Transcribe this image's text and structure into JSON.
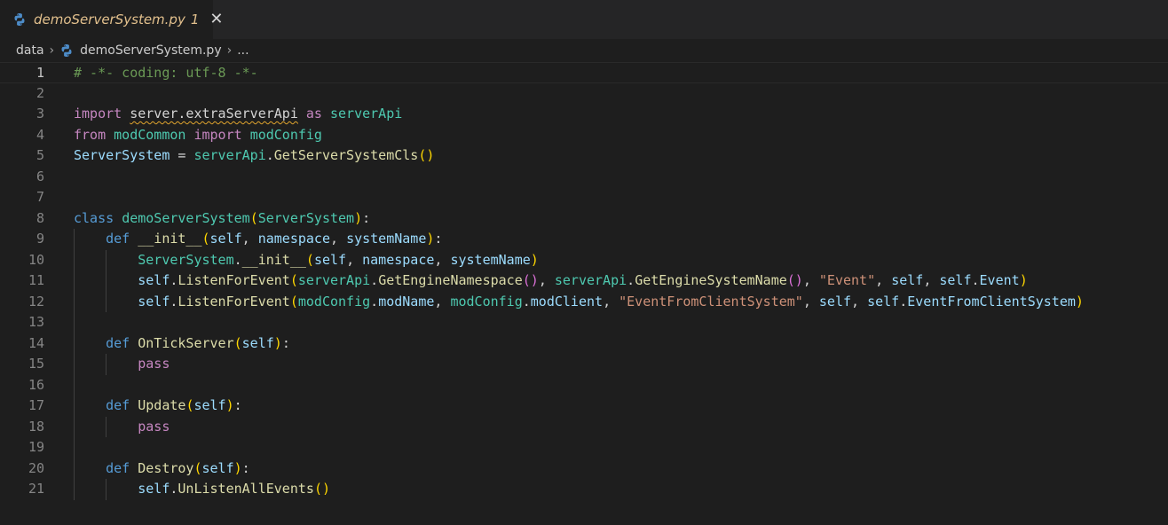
{
  "tab": {
    "file_name": "demoServerSystem.py",
    "problem_count": "1",
    "close_glyph": "✕",
    "icon": "python-icon"
  },
  "breadcrumb": {
    "folder": "data",
    "separator": "›",
    "file": "demoServerSystem.py",
    "ellipsis": "..."
  },
  "editor": {
    "current_line": 1,
    "lines": [
      {
        "n": "1",
        "indent": 0,
        "tokens": [
          {
            "t": "# -*- coding: utf-8 -*-",
            "c": "t-com"
          }
        ]
      },
      {
        "n": "2",
        "indent": 0,
        "tokens": []
      },
      {
        "n": "3",
        "indent": 0,
        "tokens": [
          {
            "t": "import",
            "c": "t-kw"
          },
          {
            "t": " ",
            "c": "t-txt"
          },
          {
            "t": "server.extraServerApi",
            "c": "t-txt squiggle"
          },
          {
            "t": " ",
            "c": "t-txt"
          },
          {
            "t": "as",
            "c": "t-kw"
          },
          {
            "t": " ",
            "c": "t-txt"
          },
          {
            "t": "serverApi",
            "c": "t-ns"
          }
        ]
      },
      {
        "n": "4",
        "indent": 0,
        "tokens": [
          {
            "t": "from",
            "c": "t-kw"
          },
          {
            "t": " ",
            "c": "t-txt"
          },
          {
            "t": "modCommon",
            "c": "t-ns"
          },
          {
            "t": " ",
            "c": "t-txt"
          },
          {
            "t": "import",
            "c": "t-kw"
          },
          {
            "t": " ",
            "c": "t-txt"
          },
          {
            "t": "modConfig",
            "c": "t-ns"
          }
        ]
      },
      {
        "n": "5",
        "indent": 0,
        "tokens": [
          {
            "t": "ServerSystem",
            "c": "t-var"
          },
          {
            "t": " = ",
            "c": "t-op"
          },
          {
            "t": "serverApi",
            "c": "t-ns"
          },
          {
            "t": ".",
            "c": "t-txt"
          },
          {
            "t": "GetServerSystemCls",
            "c": "t-fn"
          },
          {
            "t": "()",
            "c": "t-p1"
          }
        ]
      },
      {
        "n": "6",
        "indent": 0,
        "tokens": []
      },
      {
        "n": "7",
        "indent": 0,
        "tokens": []
      },
      {
        "n": "8",
        "indent": 0,
        "tokens": [
          {
            "t": "class",
            "c": "t-kwb"
          },
          {
            "t": " ",
            "c": "t-txt"
          },
          {
            "t": "demoServerSystem",
            "c": "t-cls"
          },
          {
            "t": "(",
            "c": "t-p1"
          },
          {
            "t": "ServerSystem",
            "c": "t-cls"
          },
          {
            "t": ")",
            "c": "t-p1"
          },
          {
            "t": ":",
            "c": "t-txt"
          }
        ]
      },
      {
        "n": "9",
        "indent": 1,
        "tokens": [
          {
            "t": "    ",
            "c": "t-txt"
          },
          {
            "t": "def",
            "c": "t-kwb"
          },
          {
            "t": " ",
            "c": "t-txt"
          },
          {
            "t": "__init__",
            "c": "t-fn"
          },
          {
            "t": "(",
            "c": "t-p1"
          },
          {
            "t": "self",
            "c": "t-var"
          },
          {
            "t": ", ",
            "c": "t-txt"
          },
          {
            "t": "namespace",
            "c": "t-var"
          },
          {
            "t": ", ",
            "c": "t-txt"
          },
          {
            "t": "systemName",
            "c": "t-var"
          },
          {
            "t": ")",
            "c": "t-p1"
          },
          {
            "t": ":",
            "c": "t-txt"
          }
        ]
      },
      {
        "n": "10",
        "indent": 2,
        "tokens": [
          {
            "t": "        ",
            "c": "t-txt"
          },
          {
            "t": "ServerSystem",
            "c": "t-cls"
          },
          {
            "t": ".",
            "c": "t-txt"
          },
          {
            "t": "__init__",
            "c": "t-fn"
          },
          {
            "t": "(",
            "c": "t-p1"
          },
          {
            "t": "self",
            "c": "t-var"
          },
          {
            "t": ", ",
            "c": "t-txt"
          },
          {
            "t": "namespace",
            "c": "t-var"
          },
          {
            "t": ", ",
            "c": "t-txt"
          },
          {
            "t": "systemName",
            "c": "t-var"
          },
          {
            "t": ")",
            "c": "t-p1"
          }
        ]
      },
      {
        "n": "11",
        "indent": 2,
        "tokens": [
          {
            "t": "        ",
            "c": "t-txt"
          },
          {
            "t": "self",
            "c": "t-var"
          },
          {
            "t": ".",
            "c": "t-txt"
          },
          {
            "t": "ListenForEvent",
            "c": "t-fn"
          },
          {
            "t": "(",
            "c": "t-p1"
          },
          {
            "t": "serverApi",
            "c": "t-ns"
          },
          {
            "t": ".",
            "c": "t-txt"
          },
          {
            "t": "GetEngineNamespace",
            "c": "t-fn"
          },
          {
            "t": "()",
            "c": "t-p2"
          },
          {
            "t": ", ",
            "c": "t-txt"
          },
          {
            "t": "serverApi",
            "c": "t-ns"
          },
          {
            "t": ".",
            "c": "t-txt"
          },
          {
            "t": "GetEngineSystemName",
            "c": "t-fn"
          },
          {
            "t": "()",
            "c": "t-p2"
          },
          {
            "t": ", ",
            "c": "t-txt"
          },
          {
            "t": "\"Event\"",
            "c": "t-str"
          },
          {
            "t": ", ",
            "c": "t-txt"
          },
          {
            "t": "self",
            "c": "t-var"
          },
          {
            "t": ", ",
            "c": "t-txt"
          },
          {
            "t": "self",
            "c": "t-var"
          },
          {
            "t": ".",
            "c": "t-txt"
          },
          {
            "t": "Event",
            "c": "t-var"
          },
          {
            "t": ")",
            "c": "t-p1"
          }
        ]
      },
      {
        "n": "12",
        "indent": 2,
        "tokens": [
          {
            "t": "        ",
            "c": "t-txt"
          },
          {
            "t": "self",
            "c": "t-var"
          },
          {
            "t": ".",
            "c": "t-txt"
          },
          {
            "t": "ListenForEvent",
            "c": "t-fn"
          },
          {
            "t": "(",
            "c": "t-p1"
          },
          {
            "t": "modConfig",
            "c": "t-ns"
          },
          {
            "t": ".",
            "c": "t-txt"
          },
          {
            "t": "modName",
            "c": "t-var"
          },
          {
            "t": ", ",
            "c": "t-txt"
          },
          {
            "t": "modConfig",
            "c": "t-ns"
          },
          {
            "t": ".",
            "c": "t-txt"
          },
          {
            "t": "modClient",
            "c": "t-var"
          },
          {
            "t": ", ",
            "c": "t-txt"
          },
          {
            "t": "\"EventFromClientSystem\"",
            "c": "t-str"
          },
          {
            "t": ", ",
            "c": "t-txt"
          },
          {
            "t": "self",
            "c": "t-var"
          },
          {
            "t": ", ",
            "c": "t-txt"
          },
          {
            "t": "self",
            "c": "t-var"
          },
          {
            "t": ".",
            "c": "t-txt"
          },
          {
            "t": "EventFromClientSystem",
            "c": "t-var"
          },
          {
            "t": ")",
            "c": "t-p1"
          }
        ]
      },
      {
        "n": "13",
        "indent": 1,
        "tokens": []
      },
      {
        "n": "14",
        "indent": 1,
        "tokens": [
          {
            "t": "    ",
            "c": "t-txt"
          },
          {
            "t": "def",
            "c": "t-kwb"
          },
          {
            "t": " ",
            "c": "t-txt"
          },
          {
            "t": "OnTickServer",
            "c": "t-fn"
          },
          {
            "t": "(",
            "c": "t-p1"
          },
          {
            "t": "self",
            "c": "t-var"
          },
          {
            "t": ")",
            "c": "t-p1"
          },
          {
            "t": ":",
            "c": "t-txt"
          }
        ]
      },
      {
        "n": "15",
        "indent": 2,
        "tokens": [
          {
            "t": "        ",
            "c": "t-txt"
          },
          {
            "t": "pass",
            "c": "t-kw"
          }
        ]
      },
      {
        "n": "16",
        "indent": 1,
        "tokens": []
      },
      {
        "n": "17",
        "indent": 1,
        "tokens": [
          {
            "t": "    ",
            "c": "t-txt"
          },
          {
            "t": "def",
            "c": "t-kwb"
          },
          {
            "t": " ",
            "c": "t-txt"
          },
          {
            "t": "Update",
            "c": "t-fn"
          },
          {
            "t": "(",
            "c": "t-p1"
          },
          {
            "t": "self",
            "c": "t-var"
          },
          {
            "t": ")",
            "c": "t-p1"
          },
          {
            "t": ":",
            "c": "t-txt"
          }
        ]
      },
      {
        "n": "18",
        "indent": 2,
        "tokens": [
          {
            "t": "        ",
            "c": "t-txt"
          },
          {
            "t": "pass",
            "c": "t-kw"
          }
        ]
      },
      {
        "n": "19",
        "indent": 1,
        "tokens": []
      },
      {
        "n": "20",
        "indent": 1,
        "tokens": [
          {
            "t": "    ",
            "c": "t-txt"
          },
          {
            "t": "def",
            "c": "t-kwb"
          },
          {
            "t": " ",
            "c": "t-txt"
          },
          {
            "t": "Destroy",
            "c": "t-fn"
          },
          {
            "t": "(",
            "c": "t-p1"
          },
          {
            "t": "self",
            "c": "t-var"
          },
          {
            "t": ")",
            "c": "t-p1"
          },
          {
            "t": ":",
            "c": "t-txt"
          }
        ]
      },
      {
        "n": "21",
        "indent": 2,
        "tokens": [
          {
            "t": "        ",
            "c": "t-txt"
          },
          {
            "t": "self",
            "c": "t-var"
          },
          {
            "t": ".",
            "c": "t-txt"
          },
          {
            "t": "UnListenAllEvents",
            "c": "t-fn"
          },
          {
            "t": "()",
            "c": "t-p1"
          }
        ]
      }
    ]
  },
  "colors": {
    "background": "#1e1e1e",
    "tabbar": "#252526",
    "modified_tab_text": "#e2c08d",
    "line_number": "#858585",
    "comment": "#6a9955",
    "keyword_control": "#c586c0",
    "keyword": "#569cd6",
    "type": "#4ec9b0",
    "function": "#dcdcaa",
    "variable": "#9cdcfe",
    "string": "#ce9178"
  }
}
